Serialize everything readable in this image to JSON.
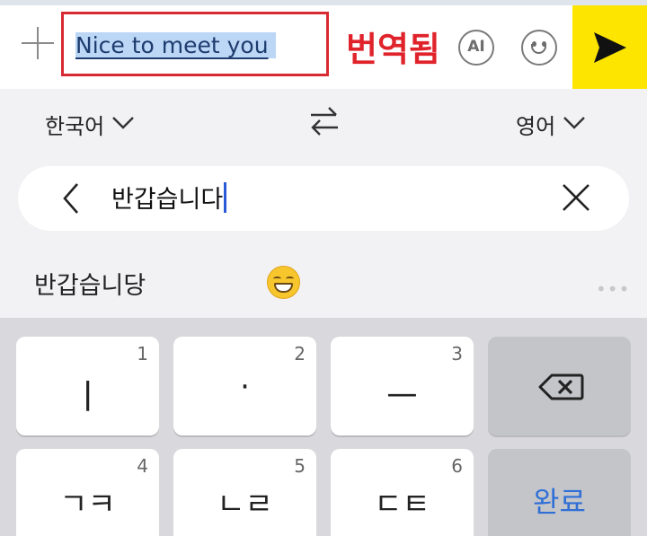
{
  "compose": {
    "message_text": "Nice to meet you",
    "translated_label": "번역됨",
    "ai_label": "AI"
  },
  "languages": {
    "source": "한국어",
    "target": "영어"
  },
  "search": {
    "value": "반갑습니다"
  },
  "suggestions": {
    "word": "반갑습니당"
  },
  "keyboard": {
    "keys": [
      {
        "glyph": "ㅣ",
        "number": "1"
      },
      {
        "glyph": "·",
        "number": "2"
      },
      {
        "glyph": "ㅡ",
        "number": "3"
      },
      {
        "glyph": "ㄱㅋ",
        "number": "4"
      },
      {
        "glyph": "ㄴㄹ",
        "number": "5"
      },
      {
        "glyph": "ㄷㅌ",
        "number": "6"
      }
    ],
    "done_label": "완료"
  },
  "colors": {
    "send_button": "#fde500",
    "highlight_box": "#d82a32",
    "translated_text": "#e0232b",
    "selection": "#bcd6f6",
    "done_label": "#2f6fd6"
  },
  "icons": [
    "plus-icon",
    "ai-icon",
    "emoji-icon",
    "send-icon",
    "chevron-down-icon",
    "swap-icon",
    "back-icon",
    "clear-icon",
    "grinning-emoji-icon",
    "more-icon",
    "backspace-icon"
  ]
}
